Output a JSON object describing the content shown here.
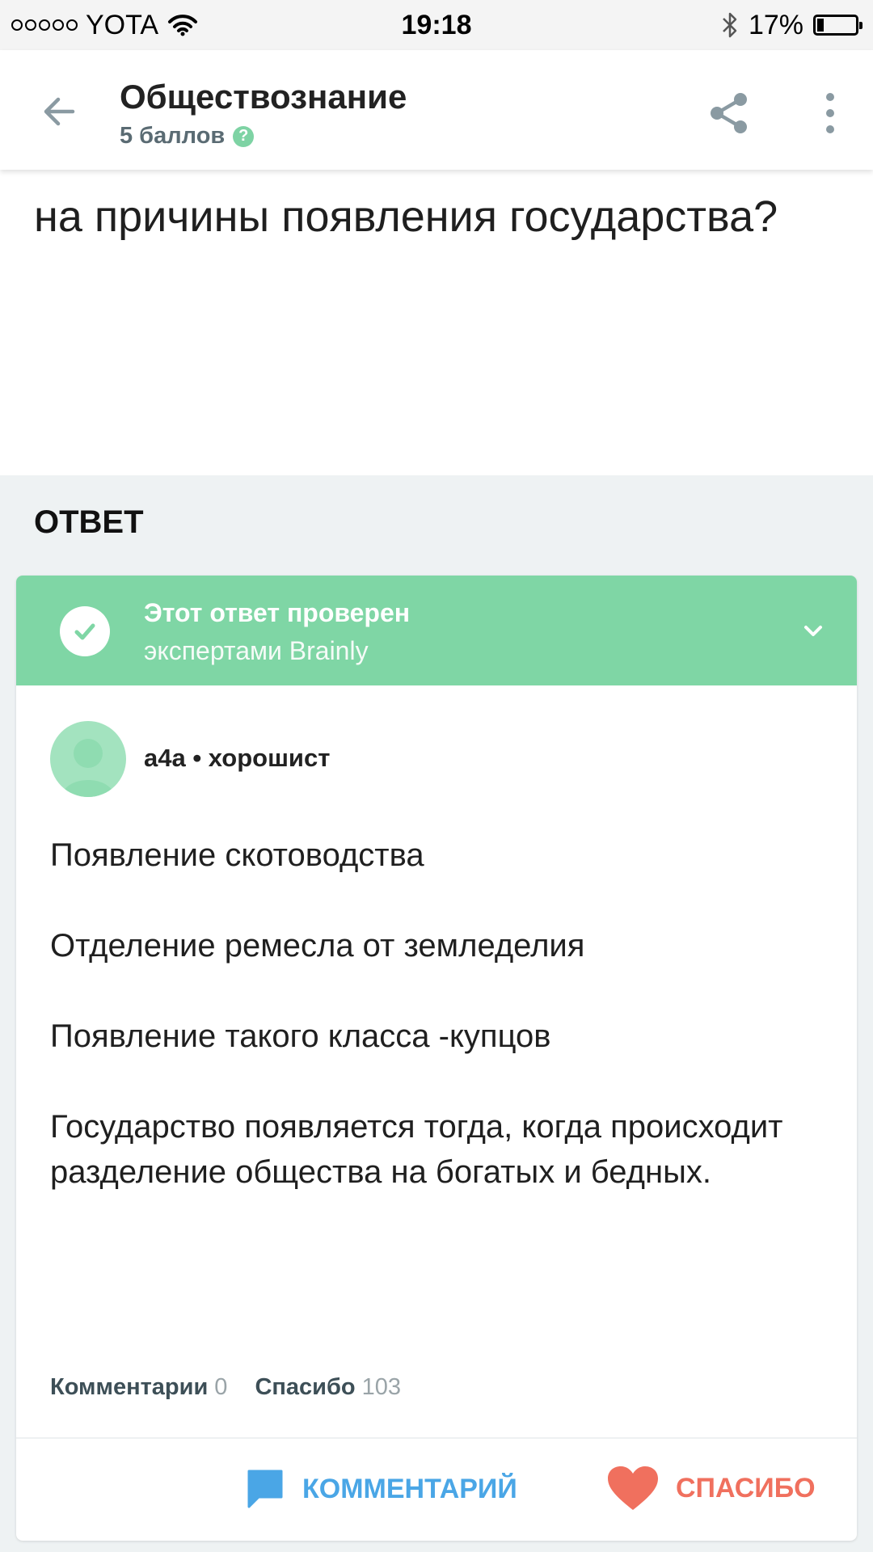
{
  "status_bar": {
    "carrier": "YOTA",
    "time": "19:18",
    "battery": "17%"
  },
  "header": {
    "title": "Обществознание",
    "points": "5 баллов",
    "help_glyph": "?"
  },
  "question": {
    "text": "на причины появления государства?"
  },
  "answer_section": {
    "label": "ОТВЕТ"
  },
  "verified_banner": {
    "title": "Этот ответ проверен",
    "subtitle": "экспертами Brainly"
  },
  "answer": {
    "author": "a4a • хорошист",
    "paragraphs": [
      "Появление скотоводства",
      "Отделение ремесла от земледелия",
      "Появление такого класса -купцов",
      "Государство появляется тогда, когда происходит разделение общества на богатых и бедных."
    ],
    "comments_label": "Комментарии",
    "comments_count": "0",
    "thanks_label": "Спасибо",
    "thanks_count": "103"
  },
  "actions": {
    "comment_label": "КОММЕНТАРИЙ",
    "thanks_label": "СПАСИБО"
  },
  "icons": [
    "back-arrow-icon",
    "help-icon",
    "share-icon",
    "more-vertical-icon",
    "check-icon",
    "chevron-down-icon",
    "avatar-icon",
    "comment-bubble-icon",
    "heart-icon",
    "wifi-icon",
    "bluetooth-icon",
    "battery-icon"
  ],
  "colors": {
    "accent_green": "#7fd6a5",
    "comment_blue": "#4aa6e6",
    "thanks_red": "#f0705e",
    "background": "#eef2f3"
  }
}
